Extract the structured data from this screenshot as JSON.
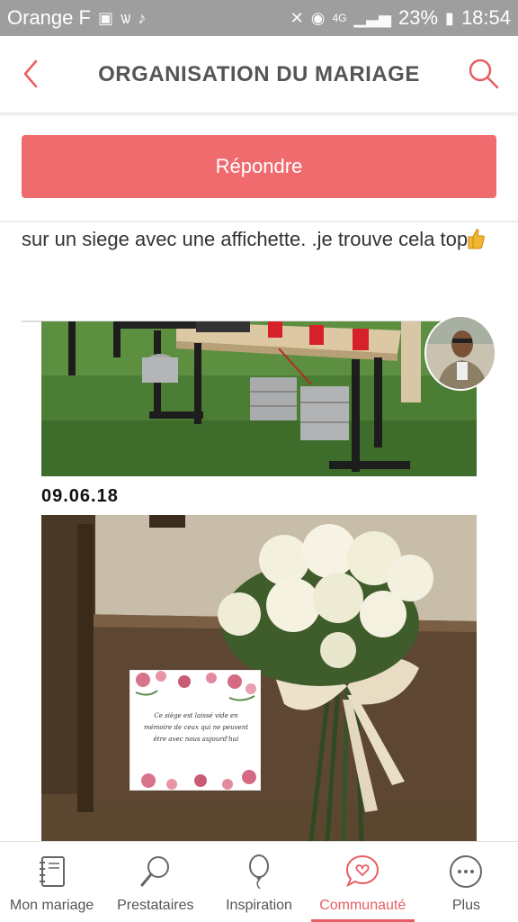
{
  "status_bar": {
    "carrier": "Orange F",
    "network": "4G",
    "battery": "23%",
    "time": "18:54"
  },
  "header": {
    "title": "ORGANISATION DU MARIAGE"
  },
  "reply_button": {
    "label": "Répondre"
  },
  "post": {
    "text": "sur un siege avec une affichette. .je trouve cela top",
    "date": "09.06.18",
    "card_text": "Ce siège est laissé vide en mémoire de ceux qui ne peuvent être avec nous aujourd'hui"
  },
  "bottom_nav": {
    "items": [
      {
        "label": "Mon mariage",
        "icon": "notebook-icon"
      },
      {
        "label": "Prestataires",
        "icon": "magnifier-icon"
      },
      {
        "label": "Inspiration",
        "icon": "balloon-icon"
      },
      {
        "label": "Communauté",
        "icon": "chat-heart-icon"
      },
      {
        "label": "Plus",
        "icon": "more-icon"
      }
    ],
    "active": "Communauté"
  },
  "colors": {
    "accent": "#f06b6e",
    "active_nav": "#e85d62",
    "status_bar_bg": "#9e9e9e",
    "title_text": "#555555"
  }
}
